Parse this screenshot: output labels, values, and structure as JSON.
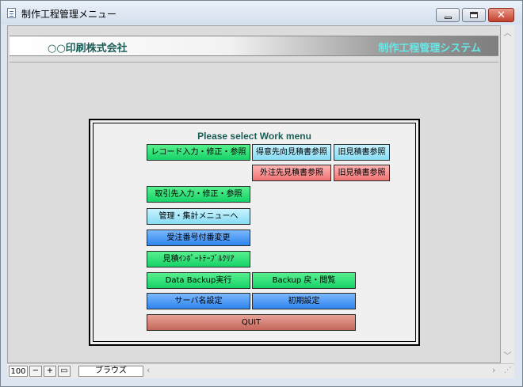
{
  "window": {
    "title": "制作工程管理メニュー"
  },
  "header": {
    "company": "○○印刷株式会社",
    "system_name": "制作工程管理システム"
  },
  "menu": {
    "heading": "Please select Work menu",
    "buttons": {
      "record_input": "レコード入力・修正・参照",
      "customer_estimate_ref": "得意先向見積書参照",
      "old_estimate_ref_1": "旧見積書参照",
      "outsource_estimate_ref": "外注先見積書参照",
      "old_estimate_ref_2": "旧見積書参照",
      "supplier_input": "取引先入力・修正・参照",
      "admin_menu": "管理・集計メニューへ",
      "order_number_change": "受注番号付番変更",
      "estimate_import_clear": "見積ｲﾝﾎﾟｰﾄﾃｰﾌﾞﾙｸﾘｱ",
      "backup_run": "Data Backup実行",
      "backup_restore": "Backup 戻・閲覧",
      "server_settings": "サーバ名設定",
      "initial_settings": "初期設定",
      "quit": "QUIT"
    }
  },
  "statusbar": {
    "zoom": "100",
    "view_mode": "ブラウズ"
  },
  "colors": {
    "green": "#16d268",
    "cyan": "#86dcf3",
    "blue": "#2d83ec",
    "pink": "#f07272",
    "quit": "#c4665a",
    "heading": "#1b5e58",
    "system_name": "#66e8e8"
  },
  "icons": [
    "document-icon",
    "minimize-icon",
    "maximize-icon",
    "close-icon",
    "chevron-up-icon",
    "chevron-down-icon",
    "chevron-left-icon",
    "chevron-right-icon",
    "minus-icon",
    "plus-icon",
    "layout-icon",
    "resize-grip-icon"
  ]
}
